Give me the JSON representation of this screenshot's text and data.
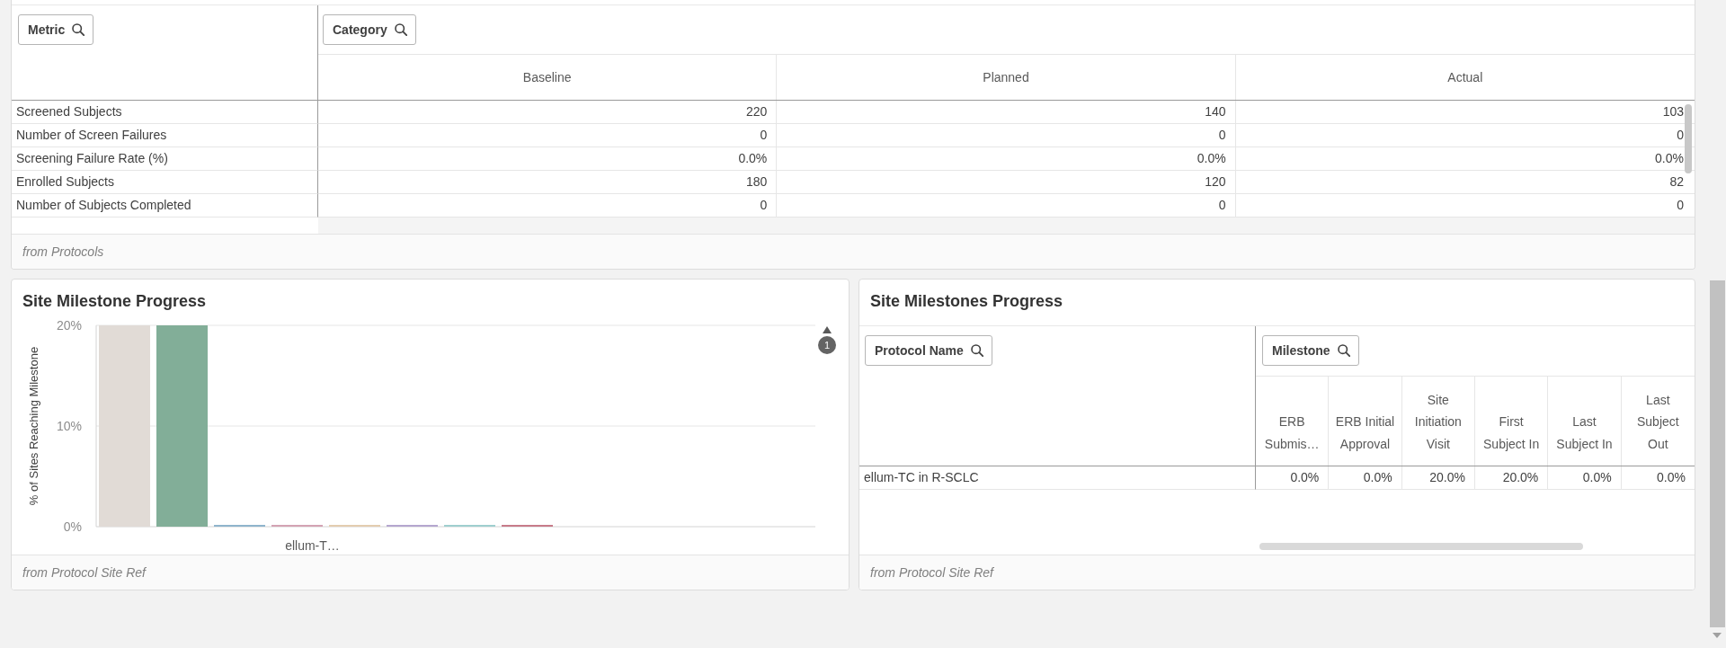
{
  "metrics_table": {
    "row_filter": "Metric",
    "column_filter": "Category",
    "columns": [
      "Baseline",
      "Planned",
      "Actual"
    ],
    "rows": [
      {
        "metric": "Screened Subjects",
        "values": [
          "220",
          "140",
          "103"
        ]
      },
      {
        "metric": "Number of Screen Failures",
        "values": [
          "0",
          "0",
          "0"
        ]
      },
      {
        "metric": "Screening Failure Rate (%)",
        "values": [
          "0.0%",
          "0.0%",
          "0.0%"
        ]
      },
      {
        "metric": "Enrolled Subjects",
        "values": [
          "180",
          "120",
          "82"
        ]
      },
      {
        "metric": "Number of Subjects Completed",
        "values": [
          "0",
          "0",
          "0"
        ]
      }
    ],
    "footer": "from Protocols"
  },
  "milestone_chart": {
    "title": "Site Milestone Progress",
    "chart_data": {
      "type": "bar",
      "ylabel": "% of Sites Reaching Milestone",
      "categories": [
        "ellum-T…"
      ],
      "series": [
        {
          "color": "#e1dbd6",
          "values": [
            20
          ]
        },
        {
          "color": "#82ae98",
          "values": [
            20
          ]
        },
        {
          "color": "#8fb4cc",
          "values": [
            0
          ]
        },
        {
          "color": "#d3a3b3",
          "values": [
            0
          ]
        },
        {
          "color": "#e3cdb0",
          "values": [
            0
          ]
        },
        {
          "color": "#b4a6cf",
          "values": [
            0
          ]
        },
        {
          "color": "#9fcfcf",
          "values": [
            0
          ]
        },
        {
          "color": "#c77b89",
          "values": [
            0
          ]
        }
      ],
      "ylim": [
        0,
        20
      ],
      "yticks": [
        {
          "value": 0,
          "label": "0%"
        },
        {
          "value": 10,
          "label": "10%"
        },
        {
          "value": 20,
          "label": "20%"
        }
      ]
    },
    "overflow_badge": "1",
    "footer": "from Protocol Site Ref"
  },
  "milestone_table": {
    "title": "Site Milestones Progress",
    "row_filter": "Protocol Name",
    "column_filter": "Milestone",
    "columns": [
      "ERB Submis…",
      "ERB Initial Approval",
      "Site Initiation Visit",
      "First Subject In",
      "Last Subject In",
      "Last Subject Out"
    ],
    "rows": [
      {
        "protocol": "ellum-TC in R-SCLC",
        "values": [
          "0.0%",
          "0.0%",
          "20.0%",
          "20.0%",
          "0.0%",
          "0.0%"
        ]
      }
    ],
    "footer": "from Protocol Site Ref"
  }
}
